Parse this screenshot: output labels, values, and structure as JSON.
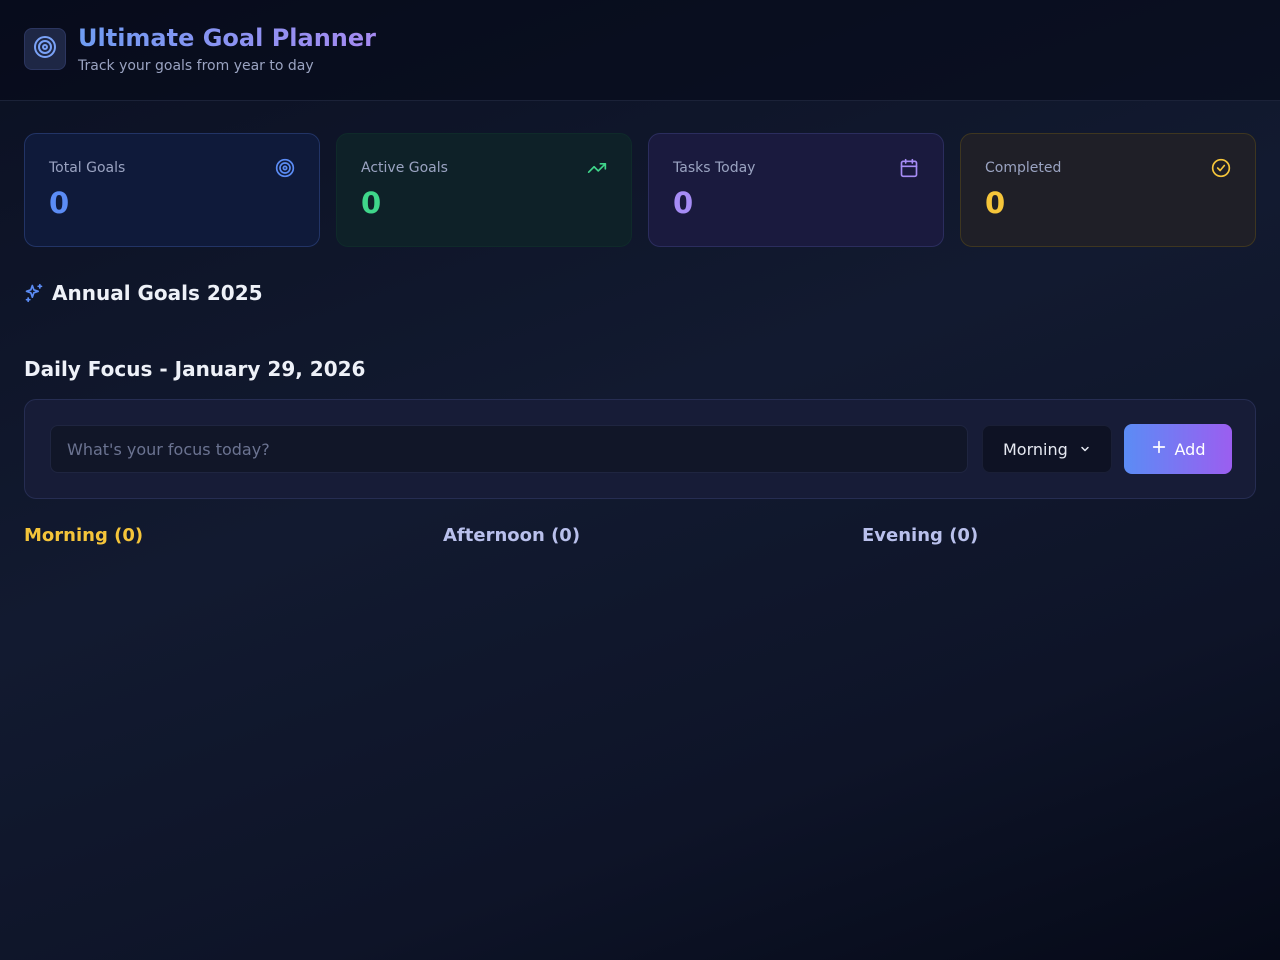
{
  "header": {
    "title": "Ultimate Goal Planner",
    "subtitle": "Track your goals from year to day",
    "logo_icon": "target-icon"
  },
  "stats": [
    {
      "label": "Total Goals",
      "value": "0",
      "icon": "target-icon",
      "color": "#5b8cf5"
    },
    {
      "label": "Active Goals",
      "value": "0",
      "icon": "trending-up-icon",
      "color": "#3fd68a"
    },
    {
      "label": "Tasks Today",
      "value": "0",
      "icon": "calendar-icon",
      "color": "#a68cf5"
    },
    {
      "label": "Completed",
      "value": "0",
      "icon": "check-circle-icon",
      "color": "#f5c53a"
    }
  ],
  "annual": {
    "title": "Annual Goals 2025",
    "icon": "sparkles-icon"
  },
  "daily": {
    "title": "Daily Focus - January 29, 2026",
    "input_placeholder": "What's your focus today?",
    "input_value": "",
    "period_selected": "Morning",
    "add_label": "Add"
  },
  "columns": [
    {
      "label": "Morning (0)",
      "color": "#f5c53a"
    },
    {
      "label": "Afternoon (0)",
      "color": "#b9c0ec"
    },
    {
      "label": "Evening (0)",
      "color": "#b9c0ec"
    }
  ]
}
